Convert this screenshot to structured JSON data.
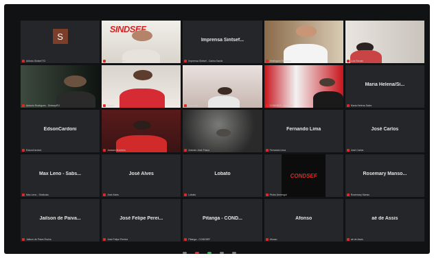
{
  "tiles": [
    {
      "name": "Arlindo Sintsef TO",
      "center": "",
      "type": "avatar",
      "initial": "S"
    },
    {
      "name": "Jeferson - Sintsef",
      "center": "",
      "type": "video-sindsef"
    },
    {
      "name": "Imprensa Sintsef - Carina Sarda",
      "center": "Imprensa Sintsef...",
      "type": "name"
    },
    {
      "name": "Wellington Pesanha",
      "center": "",
      "type": "video-man-white"
    },
    {
      "name": "Luiz Renato",
      "center": "",
      "type": "video-room"
    },
    {
      "name": "Antonio Rodrigues - Sintsep/RJ",
      "center": "",
      "type": "video-dark"
    },
    {
      "name": "Eliana",
      "center": "",
      "type": "video-woman-red"
    },
    {
      "name": "Luis Ives",
      "center": "",
      "type": "video-posters"
    },
    {
      "name": "CONDSEF - Vanderlei",
      "center": "",
      "type": "video-condsef-wall"
    },
    {
      "name": "Maria Helena Sales",
      "center": "Maria Helena/Si...",
      "type": "name"
    },
    {
      "name": "EdsonCardoni",
      "center": "EdsonCardoni",
      "type": "name"
    },
    {
      "name": "Jussara Monteiro",
      "center": "",
      "type": "video-woman-dark"
    },
    {
      "name": "Antonio José Fusco",
      "center": "",
      "type": "video-dim"
    },
    {
      "name": "Fernando Lima",
      "center": "Fernando Lima",
      "type": "name"
    },
    {
      "name": "José Carlos",
      "center": "José Carlos",
      "type": "name"
    },
    {
      "name": "Max Leno - Sindicato",
      "center": "Max Leno - Sabs...",
      "type": "name"
    },
    {
      "name": "José Alves",
      "center": "José Alves",
      "type": "name"
    },
    {
      "name": "Lobato",
      "center": "Lobato",
      "type": "name"
    },
    {
      "name": "Pedro Armengol",
      "center": "",
      "type": "video-condsef-logo"
    },
    {
      "name": "Rosemary Manso",
      "center": "Rosemary Manso...",
      "type": "name"
    },
    {
      "name": "Jailson de Paiva Rocha",
      "center": "Jailson de Paiva...",
      "type": "name"
    },
    {
      "name": "José Felipe Pereira",
      "center": "José Felipe Perei...",
      "type": "name"
    },
    {
      "name": "Pitanga - CONDSEF",
      "center": "Pitanga - COND...",
      "type": "name"
    },
    {
      "name": "Afonso",
      "center": "Afonso",
      "type": "name"
    },
    {
      "name": "aé de Assis",
      "center": "aé de Assis",
      "type": "name"
    }
  ],
  "logo_text": "SINDSEF",
  "condsef_text": "CONDSEF"
}
